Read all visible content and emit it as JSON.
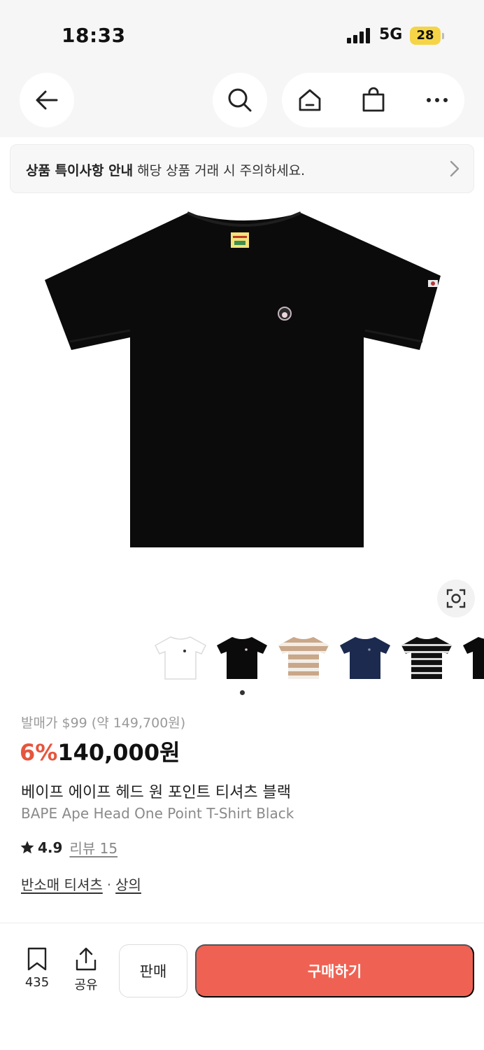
{
  "status_bar": {
    "time": "18:33",
    "network": "5G",
    "battery": "28"
  },
  "nav": {
    "icons": [
      "back-arrow-icon",
      "search-icon",
      "home-icon",
      "shopping-bag-icon",
      "more-icon"
    ]
  },
  "notice": {
    "strong": "상품 특이사항 안내",
    "text": "해당 상품 거래 시 주의하세요."
  },
  "gallery": {
    "thumbnails": [
      "white-tshirt",
      "black-tshirt",
      "beige-stripe-tshirt",
      "navy-tshirt",
      "black-stripe-tshirt",
      "black-tshirt-partial"
    ],
    "active_index": 0
  },
  "product": {
    "original_price": "발매가 $99 (약 149,700원)",
    "discount": "6%",
    "price": "140,000원",
    "name_ko": "베이프 에이프 헤드 원 포인트 티셔츠 블랙",
    "name_en": "BAPE Ape Head One Point T-Shirt Black",
    "rating": "4.9",
    "review_label": "리뷰 15",
    "category_1": "반소매 티셔츠",
    "category_sep": "·",
    "category_2": "상의"
  },
  "bottom_bar": {
    "save_count": "435",
    "share_label": "공유",
    "sell_label": "판매",
    "buy_label": "구매하기"
  },
  "colors": {
    "accent": "#ef6253",
    "discount": "#e6553d",
    "battery": "#f5d547"
  }
}
